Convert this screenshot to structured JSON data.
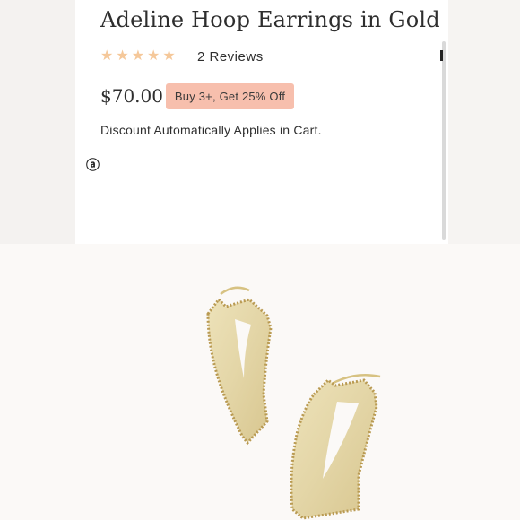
{
  "product": {
    "title": "Adeline Hoop Earrings in Gold",
    "rating_stars": 5,
    "reviews_link": "2 Reviews",
    "price": "$70.00",
    "promo_badge": "Buy 3+, Get 25% Off",
    "discount_note": "Discount Automatically Applies in Cart.",
    "partial_icon_glyph": "ⓐ"
  },
  "icons": {
    "star": "star-icon",
    "partial_logo": "afterpay-icon"
  },
  "colors": {
    "star": "#f5c89a",
    "promo_badge_bg": "#f7bfad",
    "text": "#2e2e2e",
    "gold": "#e2d4a2"
  },
  "image": {
    "subject": "pair of gold hoop earrings",
    "view": "product photo"
  }
}
